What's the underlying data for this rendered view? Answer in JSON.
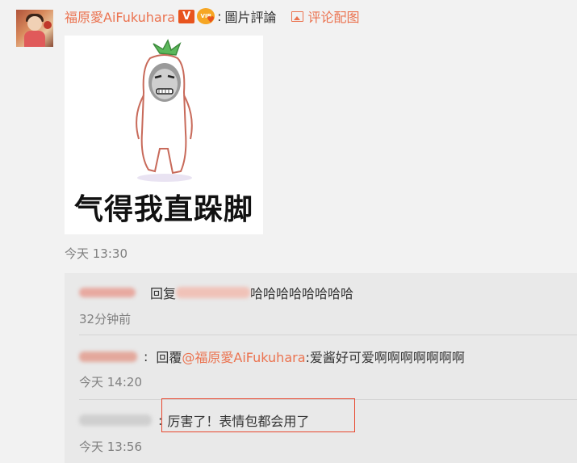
{
  "post": {
    "username": "福原愛AiFukuhara",
    "verified_badge": "V",
    "vip_badge": "VIP",
    "separator": ":",
    "text": "圖片評論",
    "comment_pic_link": "评论配图",
    "sticker_caption": "气得我直跺脚",
    "time": "今天 13:30"
  },
  "replies": [
    {
      "prefix": "回复",
      "text": "哈哈哈哈哈哈哈哈",
      "time": "32分钟前"
    },
    {
      "separator": ":",
      "prefix": "回覆",
      "mention": "@福原愛AiFukuhara",
      "text": ":爱酱好可爱啊啊啊啊啊啊啊",
      "time": "今天 14:20"
    },
    {
      "separator": ":",
      "text": "厉害了！表情包都会用了",
      "time": "今天 13:56"
    }
  ],
  "colors": {
    "accent": "#eb7350",
    "highlight_border": "#e8472e"
  },
  "icons": [
    "avatar-image",
    "verified-icon",
    "vip-icon",
    "picture-icon",
    "sticker-image"
  ]
}
